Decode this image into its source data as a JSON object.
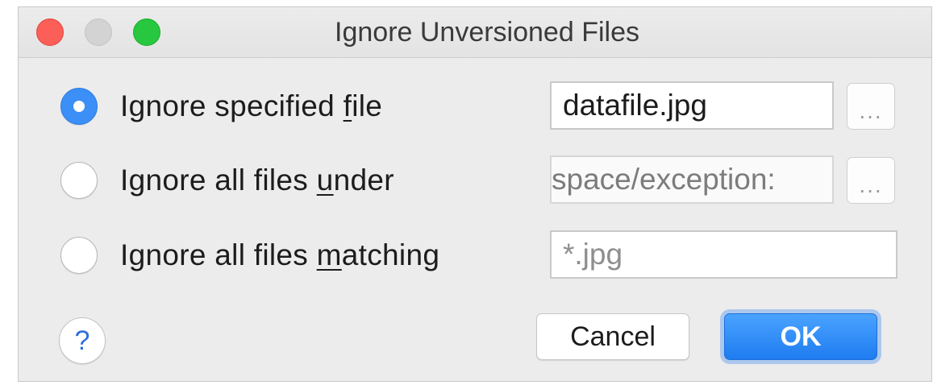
{
  "window": {
    "title": "Ignore Unversioned Files"
  },
  "options": [
    {
      "label_pre": "Ignore specified ",
      "mnemonic": "f",
      "label_post": "ile",
      "selected": true,
      "value": "datafile.jpg"
    },
    {
      "label_pre": "Ignore all files ",
      "mnemonic": "u",
      "label_post": "nder",
      "selected": false,
      "value": ":space/exception"
    },
    {
      "label_pre": "Ignore all files ",
      "mnemonic": "m",
      "label_post": "atching",
      "selected": false,
      "value": "*.jpg"
    }
  ],
  "browse_label": "...",
  "buttons": {
    "help": "?",
    "cancel": "Cancel",
    "ok": "OK"
  },
  "colors": {
    "accent": "#3b8ff6",
    "close": "#fc5f57",
    "minimize": "#d3d3d3",
    "maximize": "#27c840"
  }
}
